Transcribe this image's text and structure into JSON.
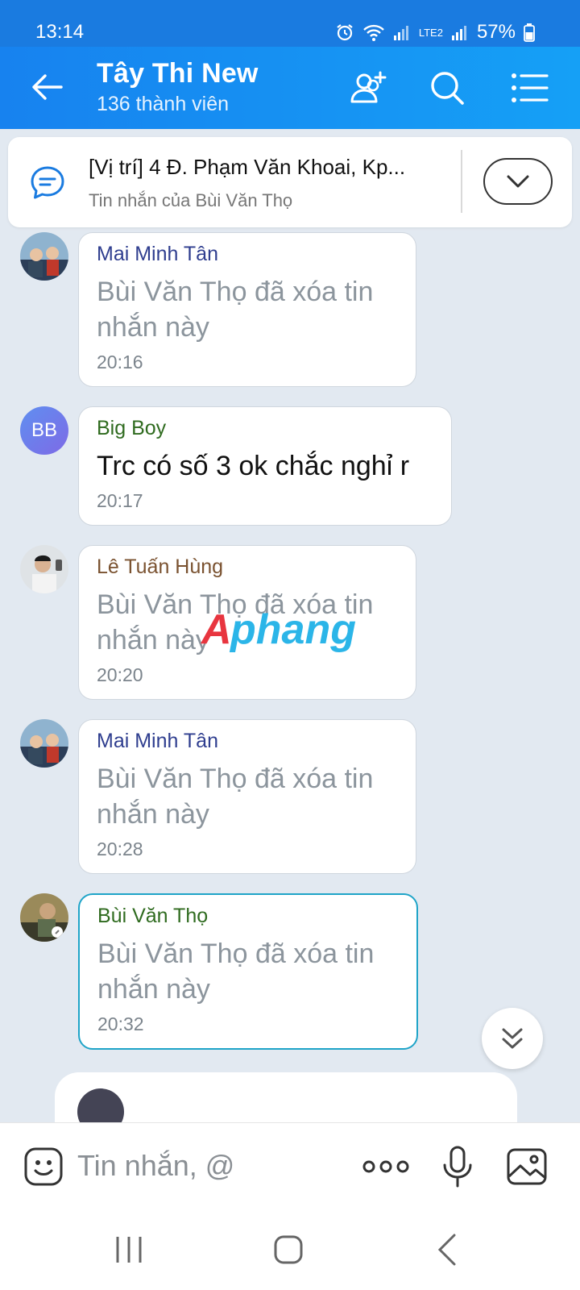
{
  "status": {
    "time": "13:14",
    "battery": "57%",
    "network": "LTE2"
  },
  "header": {
    "title": "Tây Thi New",
    "member_count": "136 thành viên"
  },
  "pinned": {
    "title": "[Vị trí] 4 Đ. Phạm Văn Khoai, Kp...",
    "subtitle": "Tin nhắn của Bùi Văn Thọ"
  },
  "messages": [
    {
      "sender": "Mai Minh Tân",
      "sender_color": "#2f3e8f",
      "text": "Bùi Văn Thọ đã xóa tin nhắn này",
      "time": "20:16",
      "deleted": true
    },
    {
      "sender": "Big Boy",
      "sender_color": "#2f6b1f",
      "avatar_initials": "BB",
      "text": "Trc có số 3 ok chắc nghỉ r",
      "time": "20:17",
      "deleted": false
    },
    {
      "sender": "Lê Tuấn Hùng",
      "sender_color": "#7a5230",
      "text": "Bùi Văn Thọ đã xóa tin nhắn này",
      "time": "20:20",
      "deleted": true
    },
    {
      "sender": "Mai Minh Tân",
      "sender_color": "#2f3e8f",
      "text": "Bùi Văn Thọ đã xóa tin nhắn này",
      "time": "20:28",
      "deleted": true
    },
    {
      "sender": "Bùi Văn Thọ",
      "sender_color": "#2f6b1f",
      "text": "Bùi Văn Thọ đã xóa tin nhắn này",
      "time": "20:32",
      "deleted": true
    }
  ],
  "watermark": "Aphang",
  "composer": {
    "placeholder": "Tin nhắn, @"
  },
  "colors": {
    "header": "#1a7be0",
    "accent": "#1fa4c8",
    "background": "#e2e9f1"
  }
}
